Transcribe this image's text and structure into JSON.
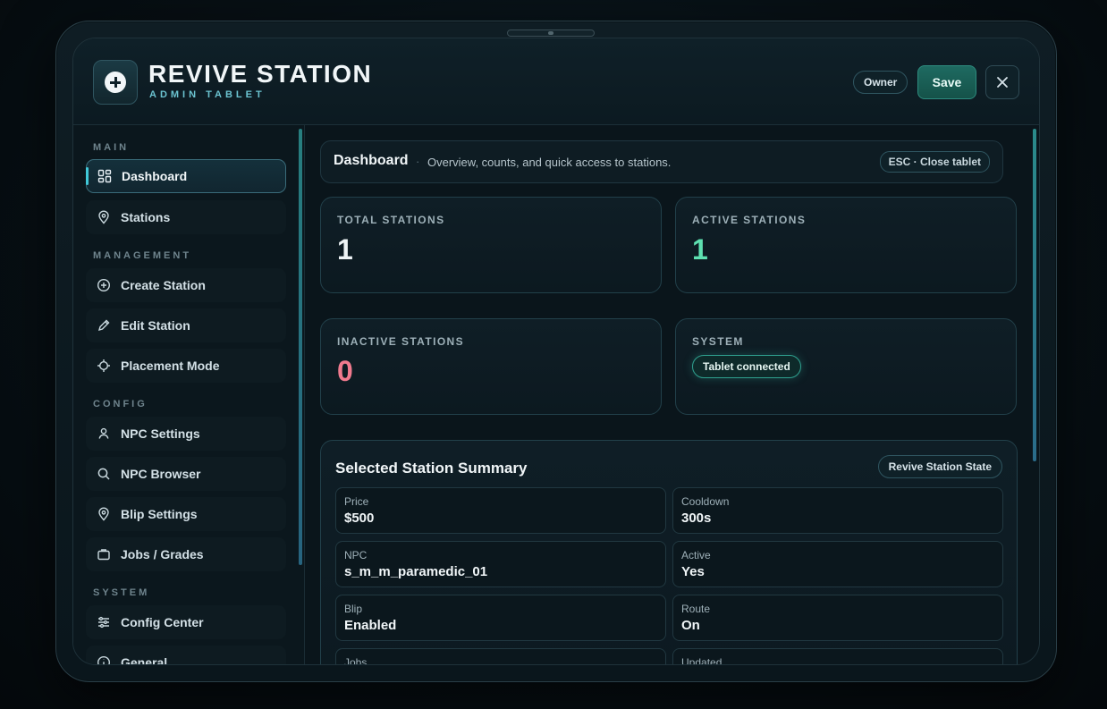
{
  "app": {
    "title": "REVIVE STATION",
    "subtitle": "ADMIN TABLET"
  },
  "header": {
    "role_badge": "Owner",
    "save_label": "Save",
    "close_icon": "close-icon"
  },
  "sidebar": {
    "sections": [
      {
        "label": "MAIN",
        "items": [
          {
            "label": "Dashboard",
            "icon": "dashboard-icon",
            "active": true
          },
          {
            "label": "Stations",
            "icon": "location-pin-icon"
          }
        ]
      },
      {
        "label": "MANAGEMENT",
        "items": [
          {
            "label": "Create Station",
            "icon": "plus-circle-icon"
          },
          {
            "label": "Edit Station",
            "icon": "pencil-icon"
          },
          {
            "label": "Placement Mode",
            "icon": "crosshair-icon"
          }
        ]
      },
      {
        "label": "CONFIG",
        "items": [
          {
            "label": "NPC Settings",
            "icon": "user-icon"
          },
          {
            "label": "NPC Browser",
            "icon": "search-icon"
          },
          {
            "label": "Blip Settings",
            "icon": "location-pin-icon"
          },
          {
            "label": "Jobs / Grades",
            "icon": "briefcase-icon"
          }
        ]
      },
      {
        "label": "SYSTEM",
        "items": [
          {
            "label": "Config Center",
            "icon": "sliders-icon"
          },
          {
            "label": "General",
            "icon": "info-icon"
          }
        ]
      }
    ]
  },
  "page": {
    "title": "Dashboard",
    "separator": "·",
    "description": "Overview, counts, and quick access to stations.",
    "esc_hint": "ESC · Close tablet"
  },
  "stats": {
    "total": {
      "label": "TOTAL STATIONS",
      "value": "1"
    },
    "active": {
      "label": "ACTIVE STATIONS",
      "value": "1"
    },
    "inactive": {
      "label": "INACTIVE STATIONS",
      "value": "0"
    },
    "system": {
      "label": "SYSTEM",
      "status": "Tablet connected"
    }
  },
  "summary": {
    "title": "Selected Station Summary",
    "badge": "Revive Station State",
    "fields": [
      {
        "key": "Price",
        "value": "$500"
      },
      {
        "key": "Cooldown",
        "value": "300s"
      },
      {
        "key": "NPC",
        "value": "s_m_m_paramedic_01"
      },
      {
        "key": "Active",
        "value": "Yes"
      },
      {
        "key": "Blip",
        "value": "Enabled"
      },
      {
        "key": "Route",
        "value": "On"
      },
      {
        "key": "Jobs",
        "value": ""
      },
      {
        "key": "Updated",
        "value": ""
      }
    ]
  },
  "colors": {
    "accent": "#40c8d8",
    "active_green": "#5ee0b0",
    "inactive_pink": "#f07a8e",
    "save_bg": "#1e6a61"
  }
}
